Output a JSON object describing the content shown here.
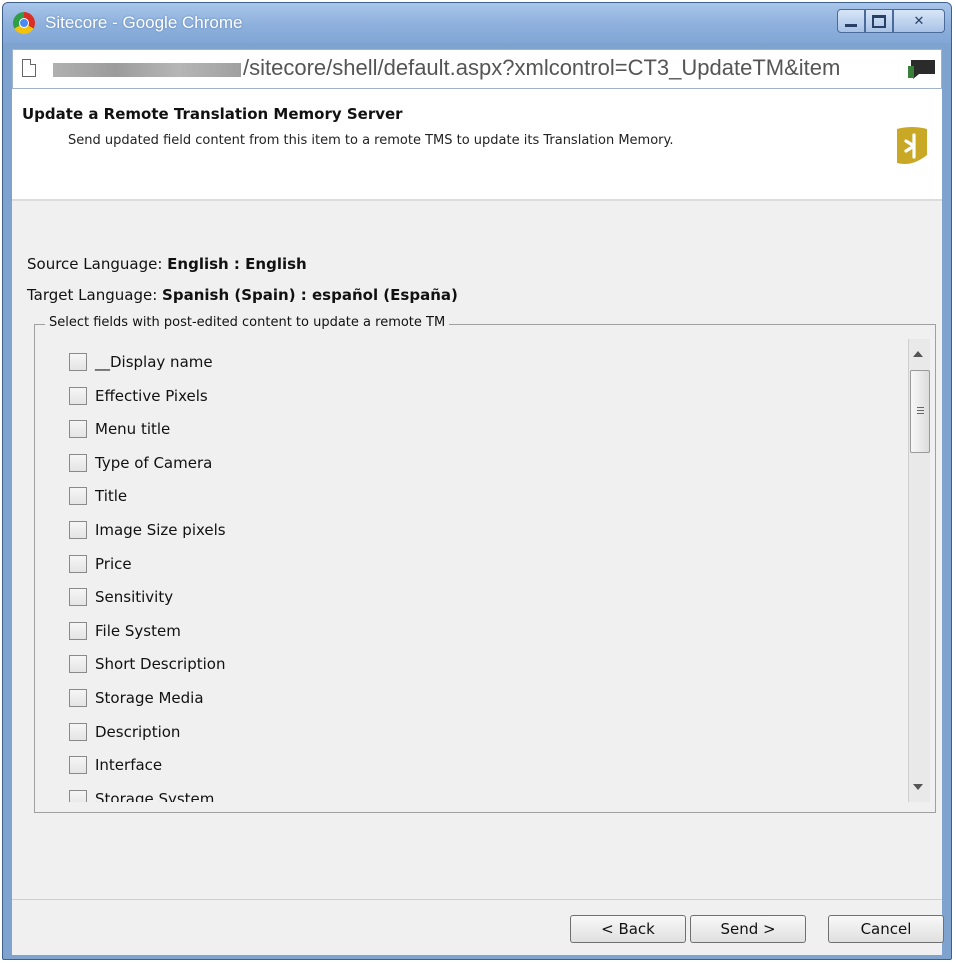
{
  "window": {
    "title": "Sitecore - Google Chrome"
  },
  "address_bar": {
    "url_visible": "/sitecore/shell/default.aspx?xmlcontrol=CT3_UpdateTM&item"
  },
  "header": {
    "title": "Update a Remote Translation Memory Server",
    "description": "Send updated field content from this item to a remote TMS to update its Translation Memory."
  },
  "source_language": {
    "label": "Source Language:",
    "value": "English : English"
  },
  "target_language": {
    "label": "Target Language:",
    "value": "Spanish (Spain) : español (España)"
  },
  "fields_group": {
    "legend": "Select fields with post-edited content to update a remote TM",
    "items": [
      {
        "label": "__Display name",
        "checked": false
      },
      {
        "label": "Effective Pixels",
        "checked": false
      },
      {
        "label": "Menu title",
        "checked": false
      },
      {
        "label": "Type of Camera",
        "checked": false
      },
      {
        "label": "Title",
        "checked": false
      },
      {
        "label": "Image Size pixels",
        "checked": false
      },
      {
        "label": "Price",
        "checked": false
      },
      {
        "label": "Sensitivity",
        "checked": false
      },
      {
        "label": "File System",
        "checked": false
      },
      {
        "label": "Short Description",
        "checked": false
      },
      {
        "label": "Storage Media",
        "checked": false
      },
      {
        "label": "Description",
        "checked": false
      },
      {
        "label": "Interface",
        "checked": false
      },
      {
        "label": "Storage System",
        "checked": false
      }
    ]
  },
  "buttons": {
    "back": "< Back",
    "send": "Send >",
    "cancel": "Cancel"
  },
  "colors": {
    "titlebar": "#8db0dc",
    "dialog_bg": "#f0f0f0",
    "logo_badge": "#c9a825"
  }
}
